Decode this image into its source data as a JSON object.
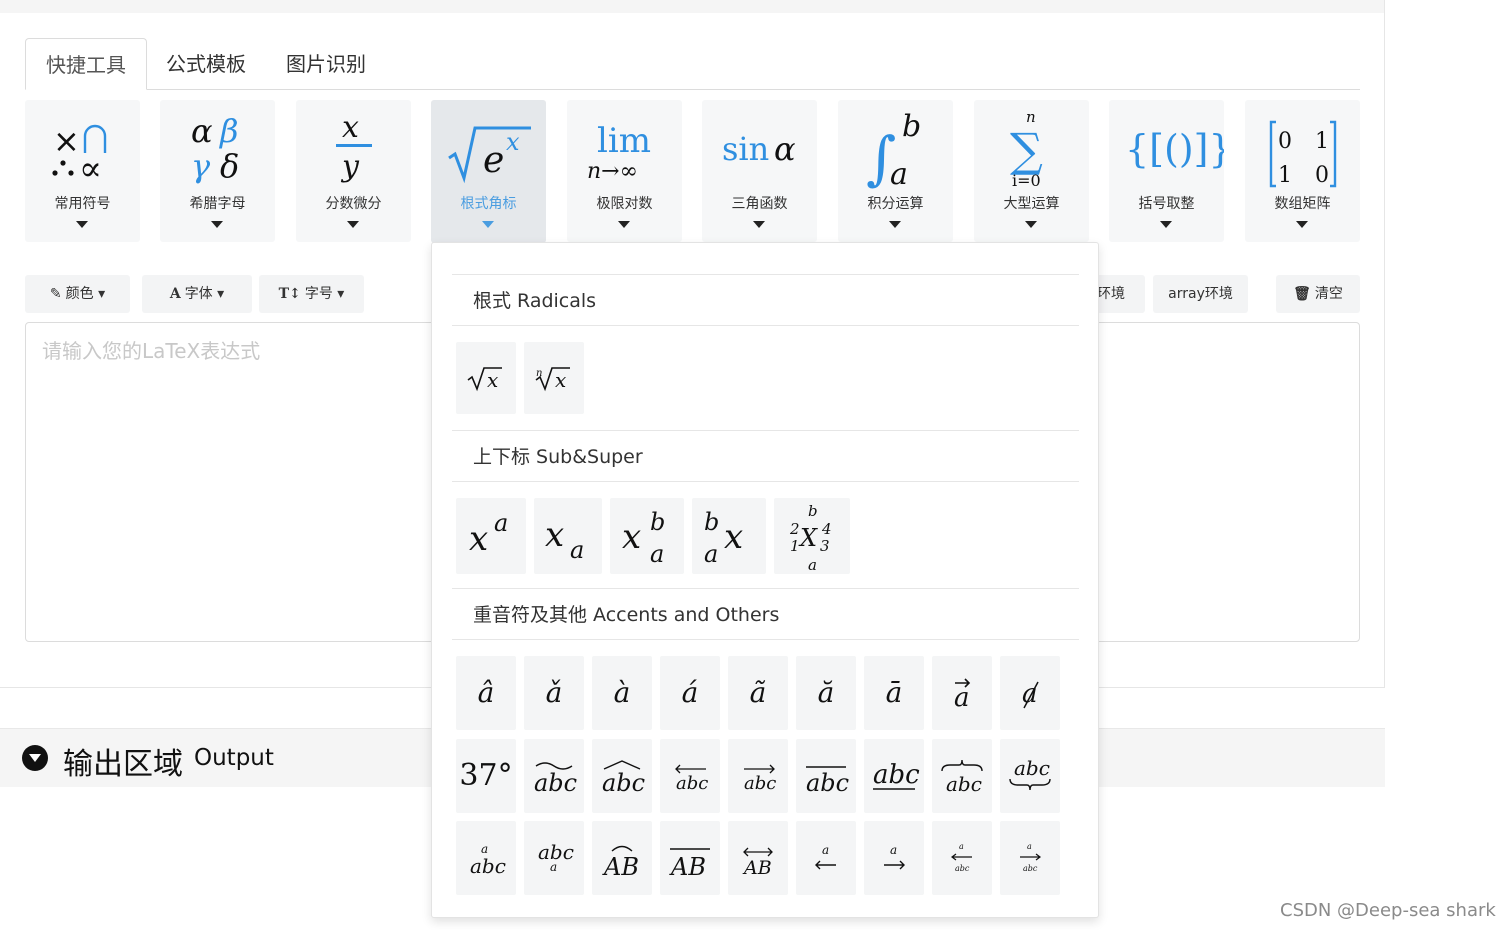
{
  "tabs": [
    "快捷工具",
    "公式模板",
    "图片识别"
  ],
  "tools": [
    {
      "label": "常用符号",
      "icon": "symbols-icon"
    },
    {
      "label": "希腊字母",
      "icon": "greek-icon"
    },
    {
      "label": "分数微分",
      "icon": "fraction-icon"
    },
    {
      "label": "根式角标",
      "icon": "radical-icon"
    },
    {
      "label": "极限对数",
      "icon": "limit-icon"
    },
    {
      "label": "三角函数",
      "icon": "trig-icon"
    },
    {
      "label": "积分运算",
      "icon": "integral-icon"
    },
    {
      "label": "大型运算",
      "icon": "sum-icon"
    },
    {
      "label": "括号取整",
      "icon": "bracket-icon"
    },
    {
      "label": "数组矩阵",
      "icon": "matrix-icon"
    }
  ],
  "toolbar": {
    "color": "颜色",
    "font": "字体",
    "size": "字号",
    "env_partial": "环境",
    "array_env": "array环境",
    "clear": "清空"
  },
  "editor": {
    "placeholder": "请输入您的LaTeX表达式"
  },
  "output": {
    "title_cn": "输出区域",
    "title_en": "Output"
  },
  "panel": {
    "sections": [
      "根式 Radicals",
      "上下标 Sub&Super",
      "重音符及其他 Accents and Others"
    ],
    "radicals": [
      "sqrt-x",
      "nth-root-x"
    ],
    "subsuper": [
      "x^a",
      "x_a",
      "x_a^b",
      "{}_a^b x",
      "{}_1^2 X_3^4"
    ],
    "accents_row1": [
      "hat",
      "check",
      "grave",
      "acute",
      "tilde",
      "breve",
      "bar",
      "vec",
      "not"
    ],
    "accents_row2": [
      "degree",
      "widetilde",
      "widehat",
      "overleftarrow",
      "overrightarrow",
      "overline",
      "underline",
      "overbrace",
      "underbrace"
    ],
    "accents_row3": [
      "overset",
      "underset",
      "overarc",
      "overline-AB",
      "overleftrightarrow",
      "xleftarrow",
      "xrightarrow",
      "xleftarrow-under",
      "xrightarrow-under"
    ]
  },
  "watermark": "CSDN @Deep-sea shark"
}
